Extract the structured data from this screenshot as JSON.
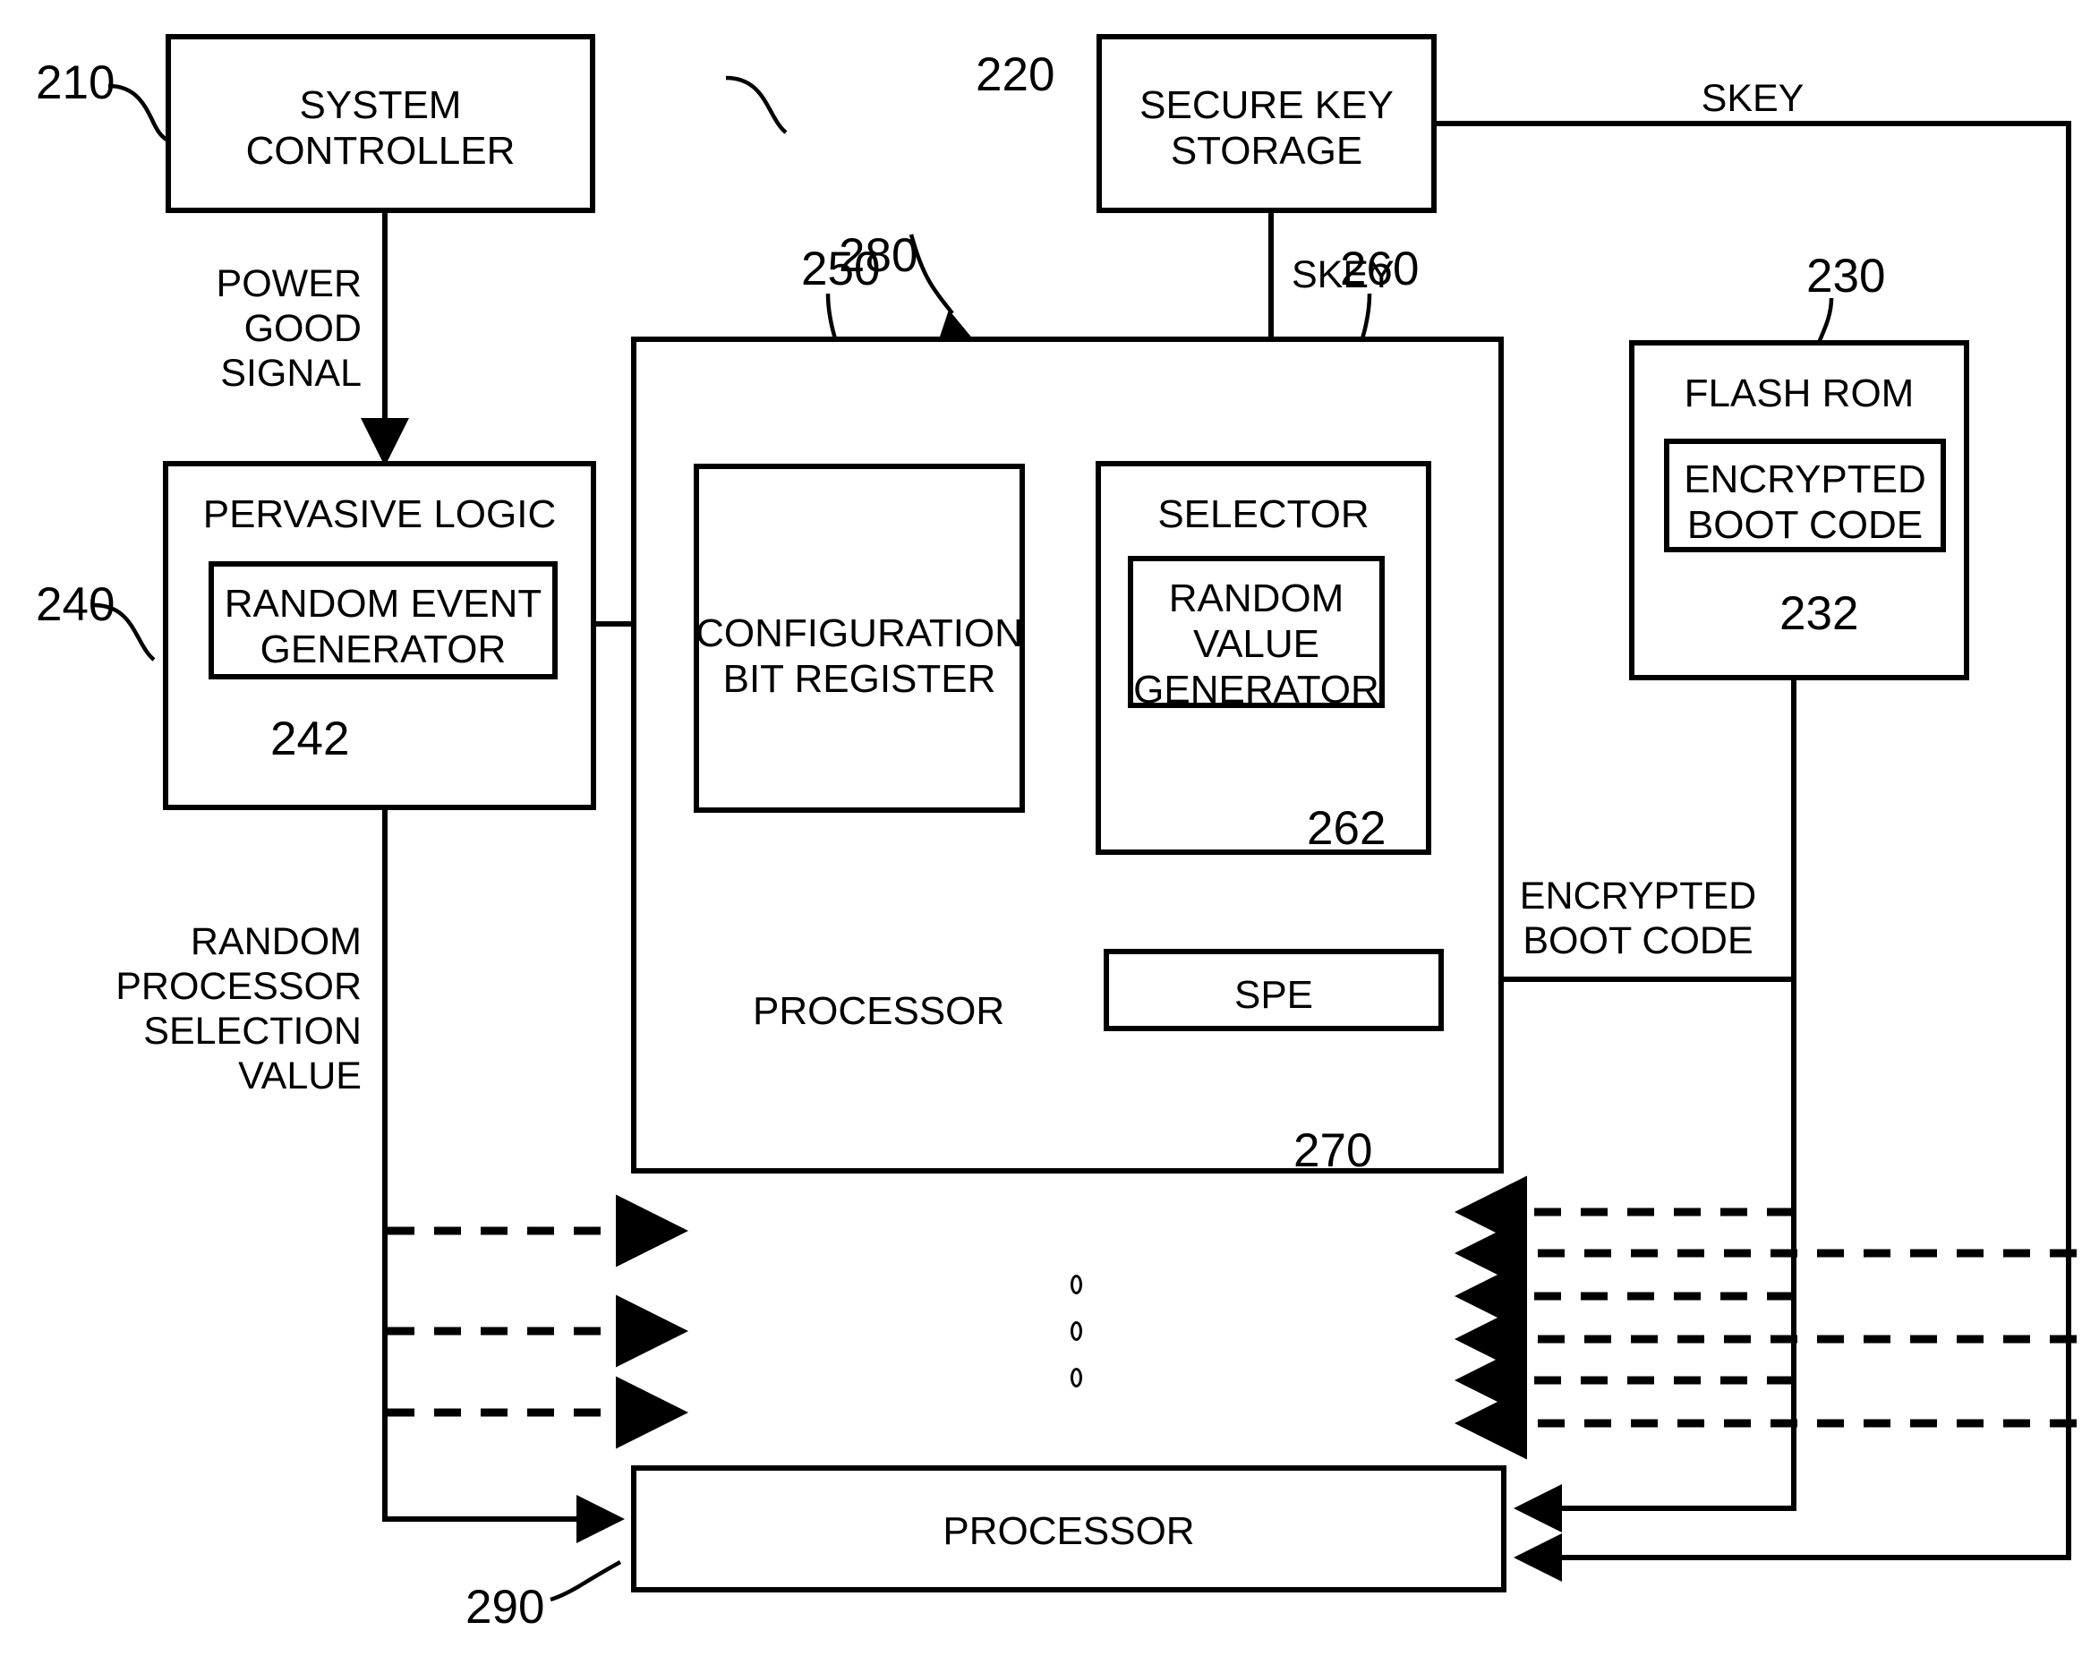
{
  "figure": {
    "title": "Secure boot processor selection block diagram",
    "background": "#ffffff",
    "line_color": "#000000"
  },
  "blocks": {
    "system_controller": {
      "label": "SYSTEM\nCONTROLLER",
      "ref": "210"
    },
    "secure_key_storage": {
      "label": "SECURE KEY\nSTORAGE",
      "ref": "220"
    },
    "flash_rom": {
      "label": "FLASH ROM",
      "ref": "230"
    },
    "encrypted_boot_code": {
      "label": "ENCRYPTED\nBOOT CODE",
      "ref": "232"
    },
    "pervasive_logic": {
      "label": "PERVASIVE LOGIC",
      "ref": "240"
    },
    "random_event_generator": {
      "label": "RANDOM EVENT\nGENERATOR",
      "ref": "242"
    },
    "configuration_bit_register": {
      "label": "CONFIGURATION\nBIT REGISTER",
      "ref": "250"
    },
    "selector": {
      "label": "SELECTOR",
      "ref": "260"
    },
    "random_value_generator": {
      "label": "RANDOM\nVALUE\nGENERATOR",
      "ref": "262"
    },
    "spe": {
      "label": "SPE",
      "ref": "270"
    },
    "processor_main": {
      "label": "PROCESSOR",
      "ref": "280"
    },
    "processor_bottom": {
      "label": "PROCESSOR",
      "ref": "290"
    }
  },
  "signals": {
    "power_good_signal": "POWER\nGOOD\nSIGNAL",
    "skey_top": "SKEY",
    "skey_right": "SKEY",
    "encrypted_boot_code_bus": "ENCRYPTED\nBOOT CODE",
    "random_processor_selection_value": "RANDOM\nPROCESSOR\nSELECTION\nVALUE"
  },
  "ellipsis": {
    "symbol": "o",
    "count": 3
  }
}
